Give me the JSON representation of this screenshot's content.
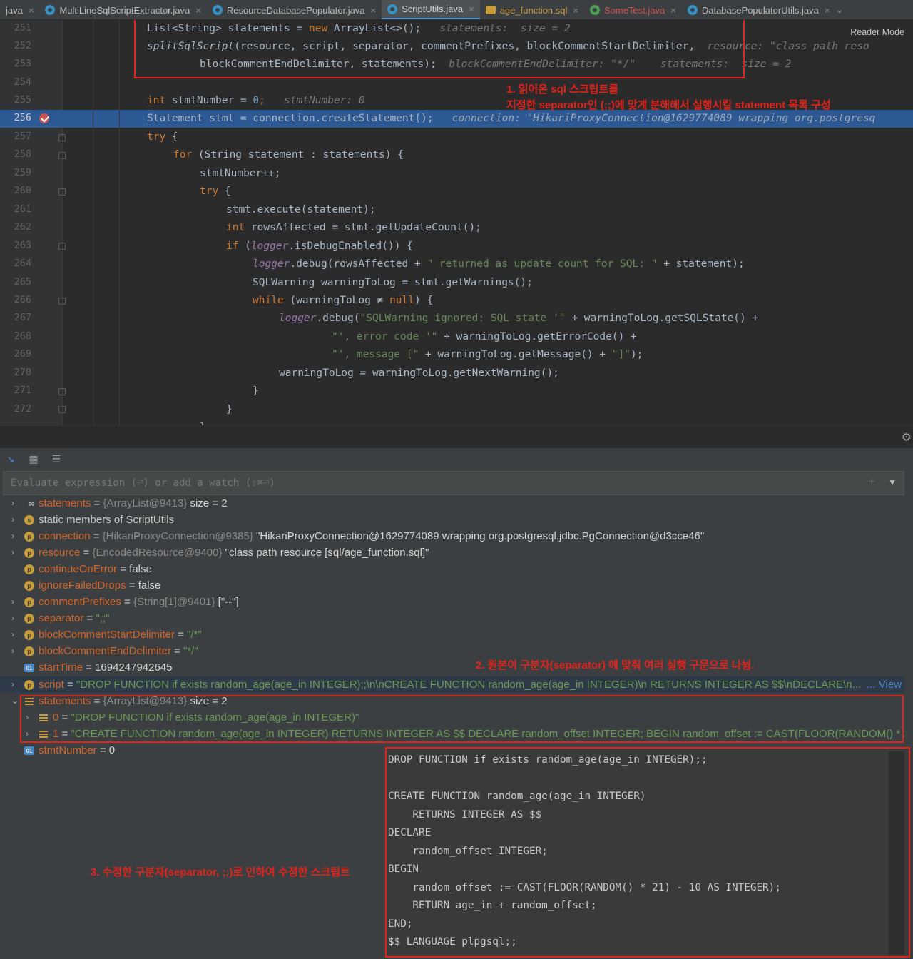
{
  "tabs": [
    {
      "label": "java",
      "icon": "none"
    },
    {
      "label": "MultiLineSqlScriptExtractor.java",
      "icon": "java-class-icon"
    },
    {
      "label": "ResourceDatabasePopulator.java",
      "icon": "java-class-icon"
    },
    {
      "label": "ScriptUtils.java",
      "icon": "java-class-icon",
      "active": true
    },
    {
      "label": "age_function.sql",
      "icon": "sql-file-icon"
    },
    {
      "label": "SomeTest.java",
      "icon": "java-test-icon"
    },
    {
      "label": "DatabasePopulatorUtils.java",
      "icon": "java-class-icon"
    }
  ],
  "reader_mode": "Reader Mode",
  "line_numbers": [
    "251",
    "252",
    "253",
    "254",
    "255",
    "256",
    "257",
    "258",
    "259",
    "260",
    "261",
    "262",
    "263",
    "264",
    "265",
    "266",
    "267",
    "268",
    "269",
    "270",
    "271",
    "272"
  ],
  "current_line": "256",
  "hints": {
    "statements": "statements:  size = 2",
    "resource": "resource: \"class path reso",
    "block_end": "blockCommentEndDelimiter: \"*/\"",
    "statements2": "statements:  size = 2",
    "stmt_number": "stmtNumber: 0",
    "connection": "connection: \"HikariProxyConnection@1629774089 wrapping org.postgresq"
  },
  "code": {
    "l251a": "List<String> statements = ",
    "l251b": "new",
    "l251c": " ArrayList<>();",
    "l252a": "splitSqlScript",
    "l252b": "(resource, script, separator, commentPrefixes, blockCommentStartDelimiter,",
    "l253": "blockCommentEndDelimiter, statements);",
    "l255a": "int",
    "l255b": " stmtNumber = ",
    "l255c": "0",
    "l255d": ";",
    "l256": "Statement stmt = connection.createStatement();",
    "l257a": "try",
    "l257b": " {",
    "l258a": "for",
    "l258b": " (String statement : statements) {",
    "l259": "stmtNumber++;",
    "l260a": "try",
    "l260b": " {",
    "l261": "stmt.execute(statement);",
    "l262a": "int",
    "l262b": " rowsAffected = stmt.getUpdateCount();",
    "l263a": "if",
    "l263b": " (",
    "l263c": "logger",
    "l263d": ".isDebugEnabled()) {",
    "l264a": "logger",
    "l264b": ".debug(rowsAffected + ",
    "l264c": "\" returned as update count for SQL: \"",
    "l264d": " + statement);",
    "l265": "SQLWarning warningToLog = stmt.getWarnings();",
    "l266a": "while",
    "l266b": " (warningToLog ≠ ",
    "l266c": "null",
    "l266d": ") {",
    "l267a": "logger",
    "l267b": ".debug(",
    "l267c": "\"SQLWarning ignored: SQL state '\"",
    "l267d": " + warningToLog.getSQLState() +",
    "l268a": "\"', error code '\"",
    "l268b": " + warningToLog.getErrorCode() +",
    "l269a": "\"', message [\"",
    "l269b": " + warningToLog.getMessage() + ",
    "l269c": "\"]\"",
    "l269d": ");",
    "l270": "warningToLog = warningToLog.getNextWarning();",
    "l271": "}",
    "l272": "}",
    "l273": "}"
  },
  "annotations": {
    "a1_line1": "1. 읽어온 sql 스크립트를",
    "a1_line2": "지정한 separator인 (;;)에 맞게 분해해서 실행시킬 statement 목록 구성",
    "a2": "2. 원본이 구분자(separator) 에 맞춰 여러 실행 구문으로 나뉨.",
    "a3": "3. 수정한 구분자(separator, ;;)로 인하여 수정한 스크립트"
  },
  "eval_placeholder": "Evaluate expression (⏎) or add a watch (⇧⌘⏎)",
  "variables": [
    {
      "name": "statements",
      "ref": "{ArrayList@9413}",
      "value": " size = 2",
      "icon": "watch-icon",
      "expandable": true
    },
    {
      "name": "static members of ScriptUtils",
      "ref": "",
      "value": "",
      "icon": "static-icon",
      "expandable": true,
      "plain": true
    },
    {
      "name": "connection",
      "ref": "{HikariProxyConnection@9385}",
      "value": " \"HikariProxyConnection@1629774089 wrapping org.postgresql.jdbc.PgConnection@d3cce46\"",
      "icon": "param-icon",
      "expandable": true
    },
    {
      "name": "resource",
      "ref": "{EncodedResource@9400}",
      "value": " \"class path resource [sql/age_function.sql]\"",
      "icon": "param-icon",
      "expandable": true
    },
    {
      "name": "continueOnError",
      "ref": "",
      "value": "false",
      "icon": "param-icon",
      "expandable": false
    },
    {
      "name": "ignoreFailedDrops",
      "ref": "",
      "value": "false",
      "icon": "param-icon",
      "expandable": false
    },
    {
      "name": "commentPrefixes",
      "ref": "{String[1]@9401}",
      "value": " [\"--\"]",
      "icon": "param-icon",
      "expandable": true
    },
    {
      "name": "separator",
      "ref": "",
      "value": "\";;\"",
      "icon": "param-icon",
      "expandable": true,
      "isStr": true
    },
    {
      "name": "blockCommentStartDelimiter",
      "ref": "",
      "value": "\"/*\"",
      "icon": "param-icon",
      "expandable": true,
      "isStr": true
    },
    {
      "name": "blockCommentEndDelimiter",
      "ref": "",
      "value": "\"*/\"",
      "icon": "param-icon",
      "expandable": true,
      "isStr": true
    },
    {
      "name": "startTime",
      "ref": "",
      "value": "1694247942645",
      "icon": "local-icon",
      "expandable": false
    },
    {
      "name": "script",
      "ref": "",
      "value": "\"DROP FUNCTION if exists random_age(age_in INTEGER);;\\n\\nCREATE FUNCTION random_age(age_in INTEGER)\\n    RETURNS INTEGER AS $$\\nDECLARE\\n...",
      "icon": "param-icon",
      "expandable": true,
      "isStr": true,
      "selected": true,
      "link": "View"
    },
    {
      "name": "statements",
      "ref": "{ArrayList@9413}",
      "value": " size = 2",
      "icon": "list-icon",
      "expandable": true,
      "expanded": true
    },
    {
      "name": "0",
      "ref": "",
      "value": "\"DROP FUNCTION if exists random_age(age_in INTEGER)\"",
      "icon": "list-icon",
      "expandable": true,
      "isStr": true,
      "child": true
    },
    {
      "name": "1",
      "ref": "",
      "value": "\"CREATE FUNCTION random_age(age_in INTEGER) RETURNS INTEGER AS $$ DECLARE random_offset INTEGER; BEGIN random_offset := CAST(FLOOR(RANDOM() * 21) - 10 AS INTEGER); RETURN age_in + random_offset; END; $$ LANGUAGE plpgsql\"",
      "icon": "list-icon",
      "expandable": true,
      "isStr": true,
      "child": true
    },
    {
      "name": "stmtNumber",
      "ref": "",
      "value": "0",
      "icon": "local-icon",
      "expandable": false
    }
  ],
  "popup_script": "DROP FUNCTION if exists random_age(age_in INTEGER);;\n\nCREATE FUNCTION random_age(age_in INTEGER)\n    RETURNS INTEGER AS $$\nDECLARE\n    random_offset INTEGER;\nBEGIN\n    random_offset := CAST(FLOOR(RANDOM() * 21) - 10 AS INTEGER);\n    RETURN age_in + random_offset;\nEND;\n$$ LANGUAGE plpgsql;;",
  "colors": {
    "accent": "#e0231b",
    "highlight": "#2d5a94"
  }
}
